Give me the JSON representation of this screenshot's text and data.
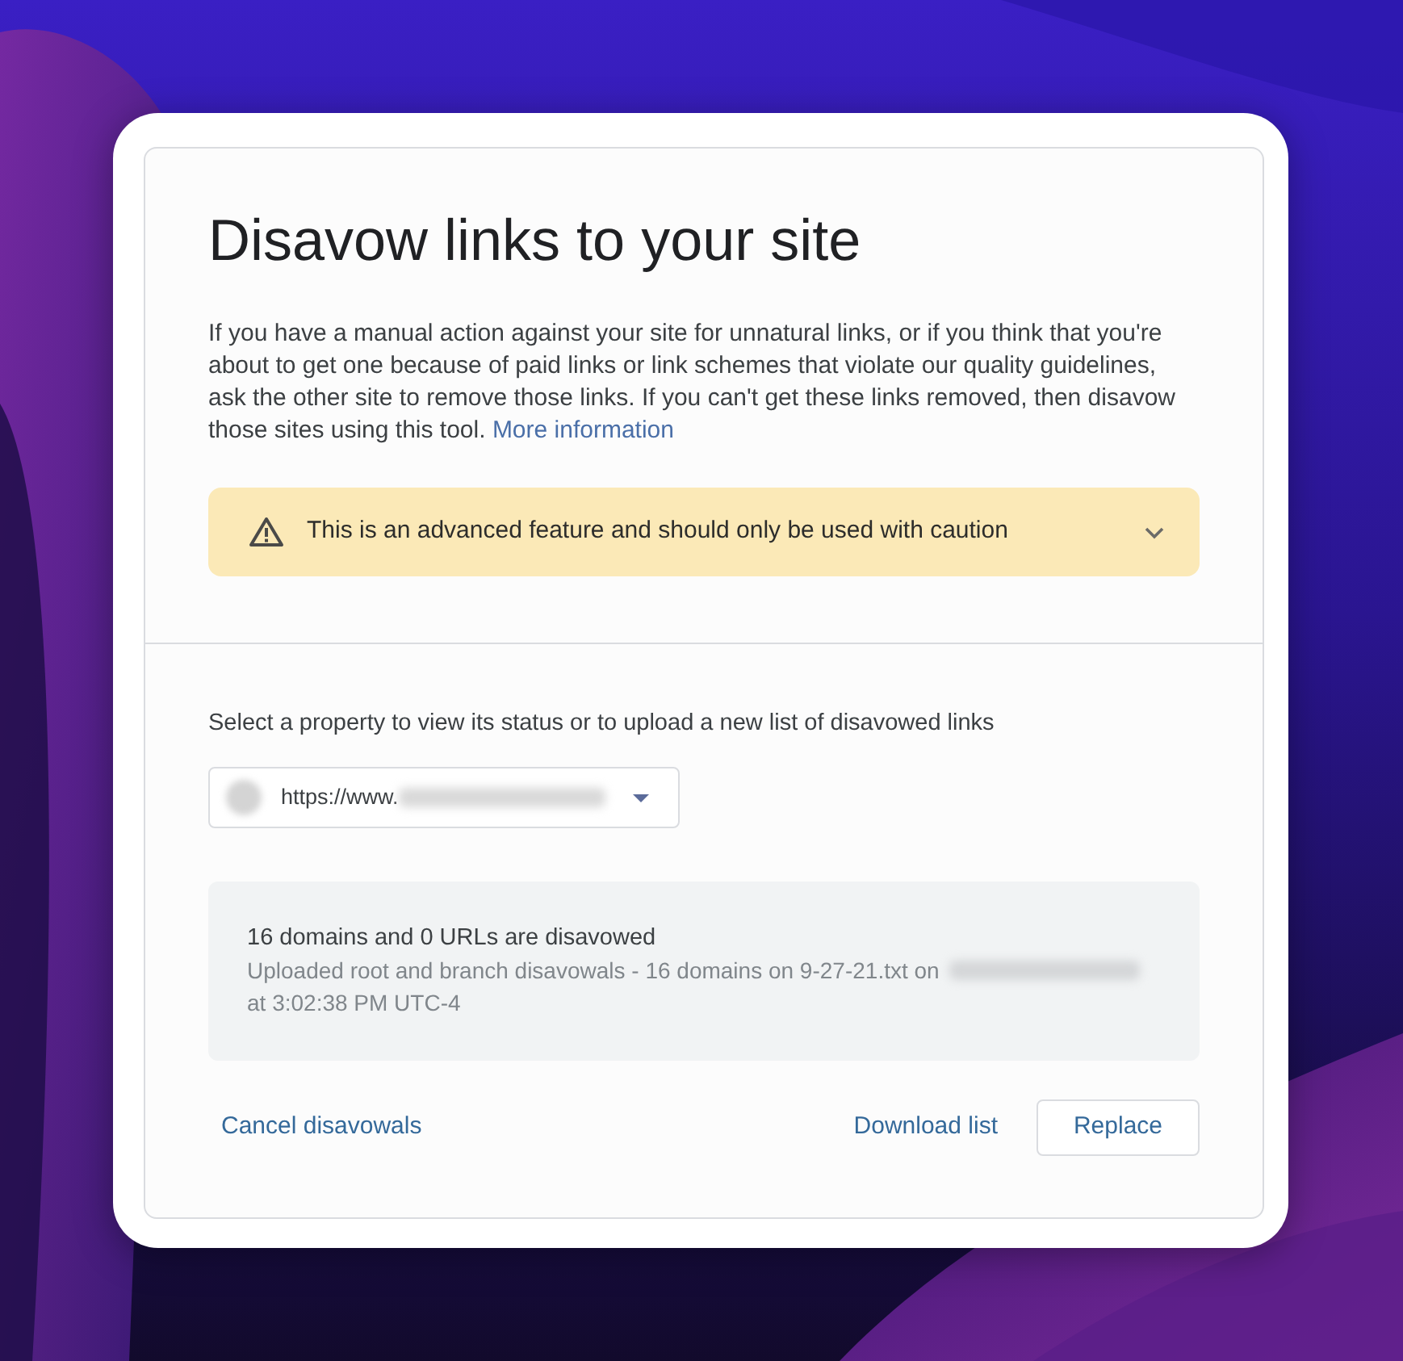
{
  "page": {
    "title": "Disavow links to your site",
    "description": "If you have a manual action against your site for unnatural links, or if you think that you're about to get one because of paid links or link schemes that violate our quality guidelines, ask the other site to remove those links. If you can't get these links removed, then disavow those sites using this tool.",
    "more_link": "More information"
  },
  "warning": {
    "text": "This is an advanced feature and should only be used with caution",
    "expanded": false
  },
  "property": {
    "prompt": "Select a property to view its status or to upload a new list of disavowed links",
    "value": "https://www."
  },
  "status": {
    "heading": "16 domains and 0 URLs are disavowed",
    "detail_before": "Uploaded root and branch disavowals - 16 domains on 9-27-21.txt on",
    "detail_after": "at 3:02:38 PM UTC-4"
  },
  "actions": [
    {
      "label": "Cancel disavowals",
      "kind": "link"
    },
    {
      "label": "Download list",
      "kind": "link"
    },
    {
      "label": "Replace",
      "kind": "outlined"
    }
  ]
}
